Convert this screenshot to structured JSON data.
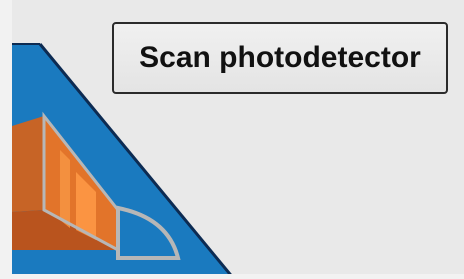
{
  "controls": {
    "scan_button_label": "Scan photodetector"
  },
  "colors": {
    "panel_blue": "#1a7abf",
    "panel_edge": "#0d2b52",
    "mirror_orange": "#e2742a",
    "outline_gray": "#b7b7b7",
    "background": "#e6e6e6"
  }
}
